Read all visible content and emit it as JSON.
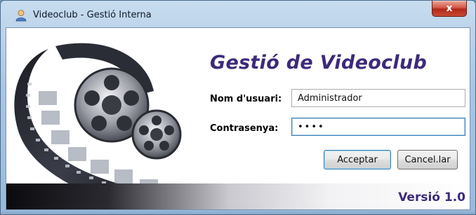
{
  "window": {
    "title": "Videoclub - Gestió Interna",
    "close_label": "x",
    "icon": "user-icon"
  },
  "login": {
    "heading": "Gestió de Videoclub",
    "username_label": "Nom d'usuari:",
    "username_value": "Administrador",
    "password_label": "Contrasenya:",
    "password_value": "••••",
    "accept_label": "Acceptar",
    "cancel_label": "Cancel.lar"
  },
  "footer": {
    "version": "Versió 1.0"
  },
  "artwork": {
    "icon": "film-reel-icon"
  },
  "colors": {
    "heading": "#3d2a7a",
    "titlebar": "#a9c6e3",
    "close": "#c74a33"
  }
}
